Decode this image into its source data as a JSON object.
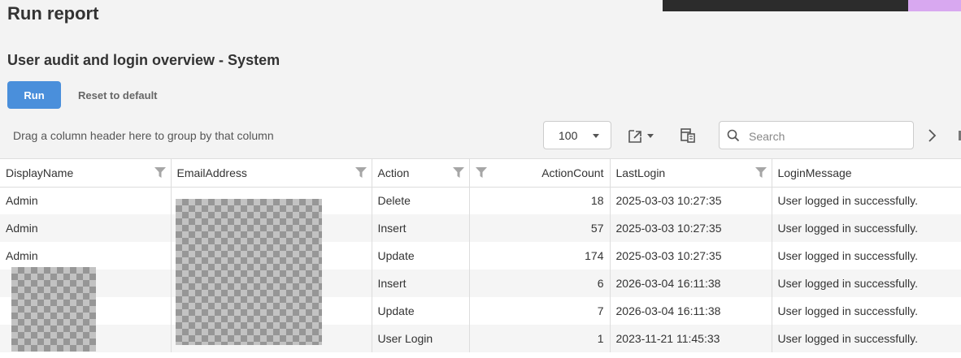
{
  "page_title": "Run report",
  "report_title": "User audit and login overview - System",
  "toolbar": {
    "run_label": "Run",
    "reset_label": "Reset to default",
    "group_hint": "Drag a column header here to group by that column",
    "page_size": "100",
    "search_placeholder": "Search"
  },
  "grid": {
    "columns": [
      "DisplayName",
      "EmailAddress",
      "Action",
      "ActionCount",
      "LastLogin",
      "LoginMessage"
    ],
    "rows": [
      {
        "display_name": "Admin",
        "email": "",
        "action": "Delete",
        "count": "18",
        "last_login": "2025-03-03 10:27:35",
        "message": "User logged in successfully."
      },
      {
        "display_name": "Admin",
        "email": "",
        "action": "Insert",
        "count": "57",
        "last_login": "2025-03-03 10:27:35",
        "message": "User logged in successfully."
      },
      {
        "display_name": "Admin",
        "email": "",
        "action": "Update",
        "count": "174",
        "last_login": "2025-03-03 10:27:35",
        "message": "User logged in successfully."
      },
      {
        "display_name": "",
        "email": "",
        "action": "Insert",
        "count": "6",
        "last_login": "2026-03-04 16:11:38",
        "message": "User logged in successfully."
      },
      {
        "display_name": "",
        "email": "",
        "action": "Update",
        "count": "7",
        "last_login": "2026-03-04 16:11:38",
        "message": "User logged in successfully."
      },
      {
        "display_name": "",
        "email": "",
        "action": "User Login",
        "count": "1",
        "last_login": "2023-11-21 11:45:33",
        "message": "User logged in successfully."
      }
    ]
  },
  "colors": {
    "primary_button": "#4a8fdb",
    "background": "#f3f3f3",
    "alt_row": "#f5f5f5"
  },
  "icons": [
    "filter-icon",
    "export-icon",
    "column-chooser-icon",
    "search-icon",
    "chevron-right-icon"
  ]
}
